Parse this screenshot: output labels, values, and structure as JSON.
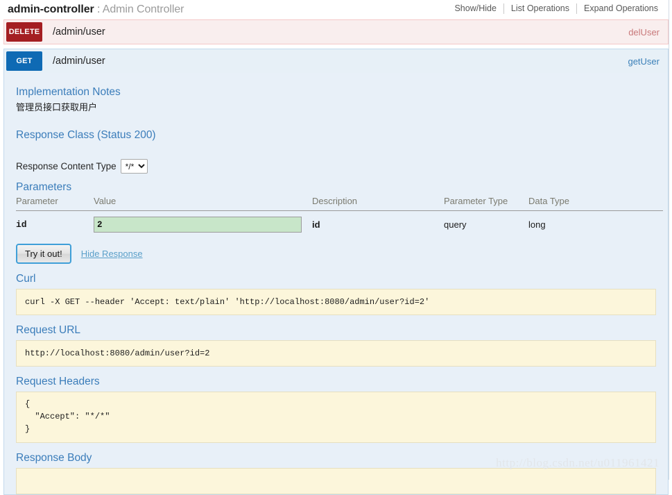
{
  "resource": {
    "name": "admin-controller",
    "separator": " : ",
    "description": "Admin Controller",
    "options": [
      {
        "label": "Show/Hide"
      },
      {
        "label": "List Operations"
      },
      {
        "label": "Expand Operations"
      }
    ]
  },
  "operations": [
    {
      "method": "DELETE",
      "path": "/admin/user",
      "nickname": "delUser",
      "accent": "#a41e22"
    },
    {
      "method": "GET",
      "path": "/admin/user",
      "nickname": "getUser",
      "accent": "#0f6ab4"
    }
  ],
  "detail": {
    "implementation_notes_title": "Implementation Notes",
    "implementation_notes_text": "管理员接口获取用户",
    "response_class_title": "Response Class (Status 200)",
    "content_type_label": "Response Content Type",
    "content_type_value": "*/*",
    "content_type_options": [
      "*/*"
    ],
    "parameters_title": "Parameters",
    "param_columns": [
      "Parameter",
      "Value",
      "Description",
      "Parameter Type",
      "Data Type"
    ],
    "param_rows": [
      {
        "parameter": "id",
        "value": "2",
        "placeholder": "",
        "description": "id",
        "parameter_type": "query",
        "data_type": "long"
      }
    ],
    "try_button": "Try it out!",
    "hide_response_link": "Hide Response",
    "curl_title": "Curl",
    "curl_text": "curl -X GET --header 'Accept: text/plain' 'http://localhost:8080/admin/user?id=2'",
    "request_url_title": "Request URL",
    "request_url_text": "http://localhost:8080/admin/user?id=2",
    "request_headers_title": "Request Headers",
    "request_headers_text": "{\n  \"Accept\": \"*/*\"\n}",
    "response_body_title": "Response Body"
  },
  "watermark": "http://blog.csdn.net/u011961421"
}
